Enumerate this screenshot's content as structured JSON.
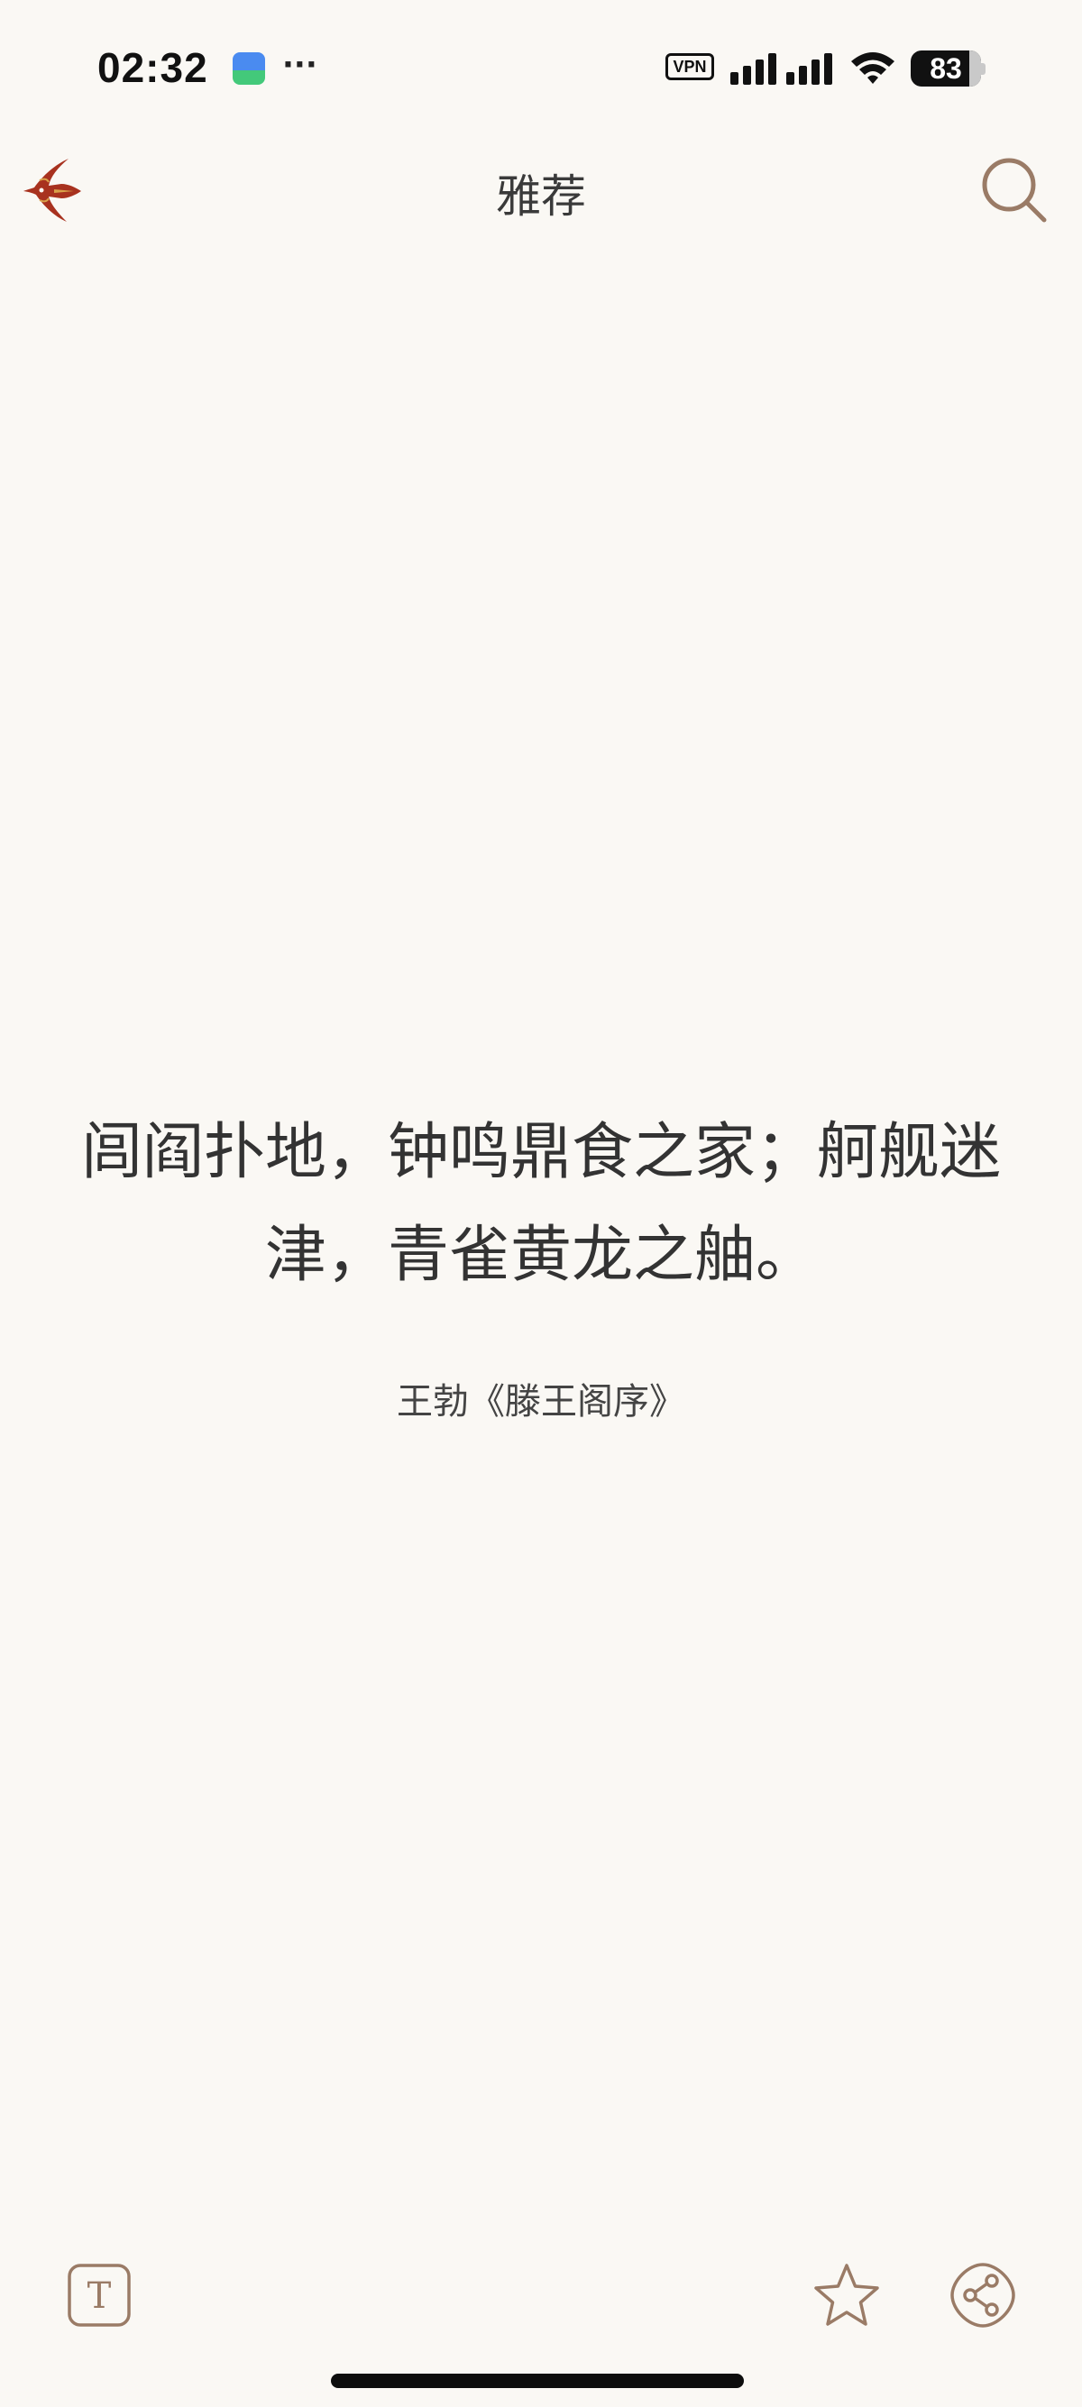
{
  "status_bar": {
    "time": "02:32",
    "more": "···",
    "vpn": "VPN",
    "battery_percent": 83,
    "battery_label": "83",
    "icons": [
      "app-icon",
      "signal-icon",
      "wifi-icon",
      "battery-icon"
    ]
  },
  "header": {
    "title": "雅荐",
    "back_icon": "swallow-back-icon",
    "search_icon": "search-icon"
  },
  "quote": {
    "text": "闾阎扑地，钟鸣鼎食之家；舸舰迷津，青雀黄龙之舳。",
    "source": "王勃《滕王阁序》"
  },
  "toolbar": {
    "font_icon": "font-size-icon",
    "font_glyph": "T",
    "favorite_icon": "star-icon",
    "share_icon": "share-icon"
  },
  "colors": {
    "background": "#faf8f4",
    "accent": "#9a7b66",
    "text": "#333333",
    "swallow": "#a8321f"
  }
}
